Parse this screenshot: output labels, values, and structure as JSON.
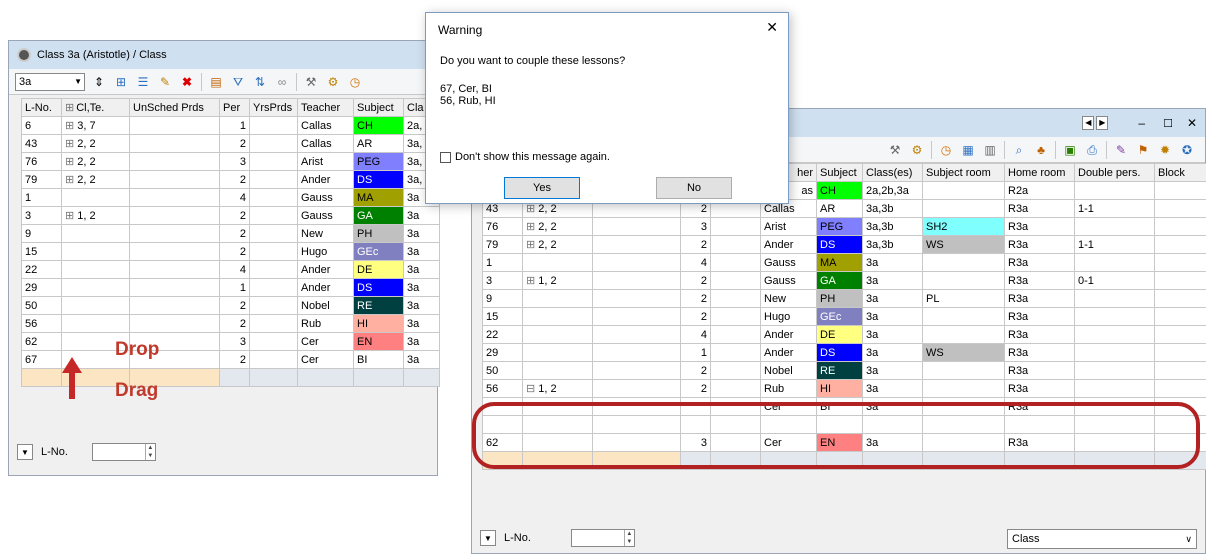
{
  "left": {
    "title": "Class 3a (Aristotle) / Class",
    "class_select": "3a",
    "headers": [
      "L-No.",
      "Cl,Te.",
      "UnSched Prds",
      "Per",
      "YrsPrds",
      "Teacher",
      "Subject",
      "Cla"
    ],
    "rows": [
      {
        "lno": "6",
        "clte": "3, 7",
        "exp": true,
        "per": "1",
        "teacher": "Callas",
        "subject": "CH",
        "color": "#00ff00",
        "fg": "#000",
        "cla": "2a,"
      },
      {
        "lno": "43",
        "clte": "2, 2",
        "exp": true,
        "per": "2",
        "teacher": "Callas",
        "subject": "AR",
        "color": "#ffffff",
        "fg": "#000",
        "cla": "3a,"
      },
      {
        "lno": "76",
        "clte": "2, 2",
        "exp": true,
        "per": "3",
        "teacher": "Arist",
        "subject": "PEG",
        "color": "#8080ff",
        "fg": "#000",
        "cla": "3a,"
      },
      {
        "lno": "79",
        "clte": "2, 2",
        "exp": true,
        "per": "2",
        "teacher": "Ander",
        "subject": "DS",
        "color": "#0000ff",
        "fg": "#fff",
        "cla": "3a,"
      },
      {
        "lno": "1",
        "clte": "",
        "exp": false,
        "per": "4",
        "teacher": "Gauss",
        "subject": "MA",
        "color": "#a0a000",
        "fg": "#000",
        "cla": "3a"
      },
      {
        "lno": "3",
        "clte": "1, 2",
        "exp": true,
        "per": "2",
        "teacher": "Gauss",
        "subject": "GA",
        "color": "#008000",
        "fg": "#fff",
        "cla": "3a"
      },
      {
        "lno": "9",
        "clte": "",
        "exp": false,
        "per": "2",
        "teacher": "New",
        "subject": "PH",
        "color": "#c0c0c0",
        "fg": "#000",
        "cla": "3a"
      },
      {
        "lno": "15",
        "clte": "",
        "exp": false,
        "per": "2",
        "teacher": "Hugo",
        "subject": "GEc",
        "color": "#8080c0",
        "fg": "#fff",
        "cla": "3a"
      },
      {
        "lno": "22",
        "clte": "",
        "exp": false,
        "per": "4",
        "teacher": "Ander",
        "subject": "DE",
        "color": "#ffff80",
        "fg": "#000",
        "cla": "3a"
      },
      {
        "lno": "29",
        "clte": "",
        "exp": false,
        "per": "1",
        "teacher": "Ander",
        "subject": "DS",
        "color": "#0000ff",
        "fg": "#fff",
        "cla": "3a"
      },
      {
        "lno": "50",
        "clte": "",
        "exp": false,
        "per": "2",
        "teacher": "Nobel",
        "subject": "RE",
        "color": "#004040",
        "fg": "#fff",
        "cla": "3a"
      },
      {
        "lno": "56",
        "clte": "",
        "exp": false,
        "per": "2",
        "teacher": "Rub",
        "subject": "HI",
        "color": "#ffb0a0",
        "fg": "#000",
        "cla": "3a"
      },
      {
        "lno": "62",
        "clte": "",
        "exp": false,
        "per": "3",
        "teacher": "Cer",
        "subject": "EN",
        "color": "#ff8080",
        "fg": "#000",
        "cla": "3a"
      },
      {
        "lno": "67",
        "clte": "",
        "exp": false,
        "per": "2",
        "teacher": "Cer",
        "subject": "BI",
        "color": "#ffffff",
        "fg": "#000",
        "cla": "3a"
      }
    ],
    "bottom_label": "L-No."
  },
  "dialog": {
    "title": "Warning",
    "question": "Do you want to couple these lessons?",
    "line1": "67, Cer, BI",
    "line2": "56, Rub, HI",
    "checkbox_label": "Don't show this message again.",
    "yes": "Yes",
    "no": "No"
  },
  "right": {
    "headers": [
      "",
      "",
      "",
      "",
      "",
      "Teacher",
      "Subject",
      "Class(es)",
      "Subject room",
      "Home room",
      "Double pers.",
      "Block"
    ],
    "teacher_header_visible": "her",
    "rows": [
      {
        "lno": "",
        "clte": "",
        "exp": false,
        "per": "",
        "teacher": "as",
        "subject": "CH",
        "color": "#00ff00",
        "fg": "#000",
        "cls": "2a,2b,3a",
        "sroom": "",
        "sroomcolor": "",
        "hroom": "R2a",
        "dbl": ""
      },
      {
        "lno": "43",
        "clte": "2, 2",
        "exp": true,
        "per": "2",
        "teacher": "Callas",
        "subject": "AR",
        "color": "#ffffff",
        "fg": "#000",
        "cls": "3a,3b",
        "sroom": "",
        "sroomcolor": "",
        "hroom": "R3a",
        "dbl": "1-1"
      },
      {
        "lno": "76",
        "clte": "2, 2",
        "exp": true,
        "per": "3",
        "teacher": "Arist",
        "subject": "PEG",
        "color": "#8080ff",
        "fg": "#000",
        "cls": "3a,3b",
        "sroom": "SH2",
        "sroomcolor": "#80ffff",
        "hroom": "R3a",
        "dbl": ""
      },
      {
        "lno": "79",
        "clte": "2, 2",
        "exp": true,
        "per": "2",
        "teacher": "Ander",
        "subject": "DS",
        "color": "#0000ff",
        "fg": "#fff",
        "cls": "3a,3b",
        "sroom": "WS",
        "sroomcolor": "#c0c0c0",
        "hroom": "R3a",
        "dbl": "1-1"
      },
      {
        "lno": "1",
        "clte": "",
        "exp": false,
        "per": "4",
        "teacher": "Gauss",
        "subject": "MA",
        "color": "#a0a000",
        "fg": "#000",
        "cls": "3a",
        "sroom": "",
        "sroomcolor": "",
        "hroom": "R3a",
        "dbl": ""
      },
      {
        "lno": "3",
        "clte": "1, 2",
        "exp": true,
        "per": "2",
        "teacher": "Gauss",
        "subject": "GA",
        "color": "#008000",
        "fg": "#fff",
        "cls": "3a",
        "sroom": "",
        "sroomcolor": "",
        "hroom": "R3a",
        "dbl": "0-1"
      },
      {
        "lno": "9",
        "clte": "",
        "exp": false,
        "per": "2",
        "teacher": "New",
        "subject": "PH",
        "color": "#c0c0c0",
        "fg": "#000",
        "cls": "3a",
        "sroom": "PL",
        "sroomcolor": "",
        "hroom": "R3a",
        "dbl": ""
      },
      {
        "lno": "15",
        "clte": "",
        "exp": false,
        "per": "2",
        "teacher": "Hugo",
        "subject": "GEc",
        "color": "#8080c0",
        "fg": "#fff",
        "cls": "3a",
        "sroom": "",
        "sroomcolor": "",
        "hroom": "R3a",
        "dbl": ""
      },
      {
        "lno": "22",
        "clte": "",
        "exp": false,
        "per": "4",
        "teacher": "Ander",
        "subject": "DE",
        "color": "#ffff80",
        "fg": "#000",
        "cls": "3a",
        "sroom": "",
        "sroomcolor": "",
        "hroom": "R3a",
        "dbl": ""
      },
      {
        "lno": "29",
        "clte": "",
        "exp": false,
        "per": "1",
        "teacher": "Ander",
        "subject": "DS",
        "color": "#0000ff",
        "fg": "#fff",
        "cls": "3a",
        "sroom": "WS",
        "sroomcolor": "#c0c0c0",
        "hroom": "R3a",
        "dbl": ""
      },
      {
        "lno": "50",
        "clte": "",
        "exp": false,
        "per": "2",
        "teacher": "Nobel",
        "subject": "RE",
        "color": "#004040",
        "fg": "#fff",
        "cls": "3a",
        "sroom": "",
        "sroomcolor": "",
        "hroom": "R3a",
        "dbl": ""
      },
      {
        "lno": "56",
        "clte": "1, 2",
        "exp": true,
        "minus": true,
        "per": "2",
        "teacher": "Rub",
        "subject": "HI",
        "color": "#ffb0a0",
        "fg": "#000",
        "cls": "3a",
        "sroom": "",
        "sroomcolor": "",
        "hroom": "R3a",
        "dbl": ""
      },
      {
        "lno": "",
        "clte": "",
        "exp": false,
        "per": "",
        "teacher": "Cer",
        "subject": "BI",
        "color": "#ffffff",
        "fg": "#000",
        "cls": "3a",
        "sroom": "",
        "sroomcolor": "",
        "hroom": "R3a",
        "dbl": ""
      },
      {
        "lno": "",
        "clte": "",
        "exp": false,
        "per": "",
        "teacher": "",
        "subject": "",
        "color": "",
        "fg": "#000",
        "cls": "",
        "sroom": "",
        "sroomcolor": "",
        "hroom": "",
        "dbl": ""
      },
      {
        "lno": "62",
        "clte": "",
        "exp": false,
        "per": "3",
        "teacher": "Cer",
        "subject": "EN",
        "color": "#ff8080",
        "fg": "#000",
        "cls": "3a",
        "sroom": "",
        "sroomcolor": "",
        "hroom": "R3a",
        "dbl": ""
      }
    ],
    "bottom_label": "L-No.",
    "view_select": "Class"
  },
  "annotations": {
    "drop": "Drop",
    "drag": "Drag"
  }
}
